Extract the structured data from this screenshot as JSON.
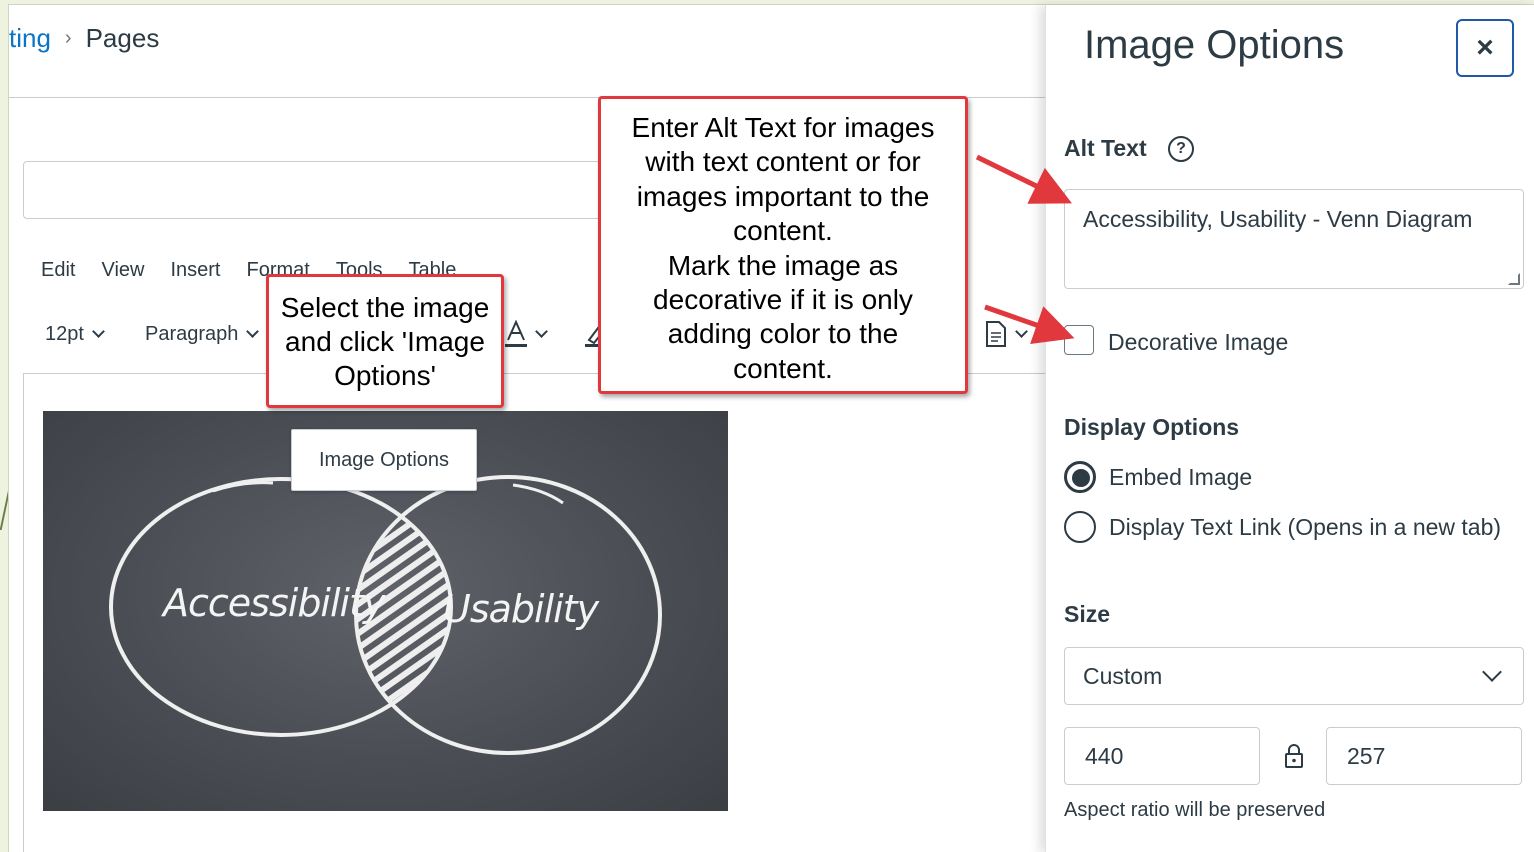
{
  "breadcrumb": {
    "parent": "ting",
    "current": "Pages"
  },
  "menubar": {
    "items": [
      "Edit",
      "View",
      "Insert",
      "Format",
      "Tools",
      "Table"
    ]
  },
  "toolbar": {
    "font_size": "12pt",
    "block_format": "Paragraph"
  },
  "image": {
    "left_label": "Accessibility",
    "right_label": "Usability"
  },
  "tooltip": {
    "label": "Image Options"
  },
  "callouts": {
    "select_image": "Select the image\nand click 'Image\nOptions'",
    "alt_text_help": "Enter Alt Text for images\nwith text content or for\nimages important to the\ncontent.\nMark the image as\ndecorative if it is only\nadding color to the\ncontent."
  },
  "panel": {
    "title": "Image Options",
    "close_label": "×",
    "alt_text_label": "Alt Text",
    "help_glyph": "?",
    "alt_text_value": "Accessibility, Usability - Venn Diagram",
    "decorative_label": "Decorative Image",
    "display_options_label": "Display Options",
    "embed_label": "Embed Image",
    "link_label": "Display Text Link (Opens in a new tab)",
    "size_label": "Size",
    "size_value": "Custom",
    "width_value": "440",
    "height_value": "257",
    "aspect_hint": "Aspect ratio will be preserved"
  },
  "colors": {
    "callout_border": "#e0383c",
    "link": "#0b74c4",
    "text": "#2d3b45",
    "focus": "#1e5aa8"
  }
}
